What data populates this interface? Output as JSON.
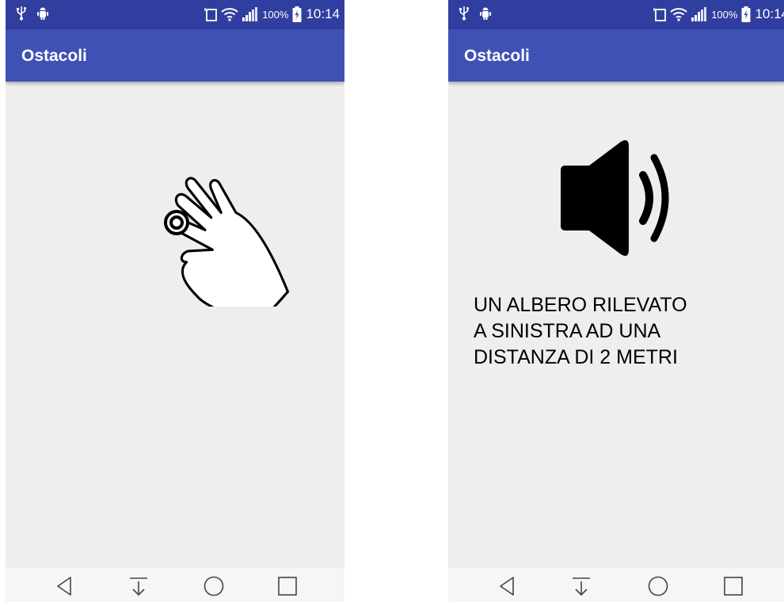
{
  "screens": [
    {
      "status": {
        "battery": "100%",
        "time": "10:14"
      },
      "app_title": "Ostacoli",
      "main_icon": "touch-gesture-hand-icon",
      "message_lines": []
    },
    {
      "status": {
        "battery": "100%",
        "time": "10:14"
      },
      "app_title": "Ostacoli",
      "main_icon": "speaker-volume-icon",
      "message_lines": [
        "UN ALBERO RILEVATO",
        "A SINISTRA AD UNA",
        "DISTANZA DI 2 METRI"
      ]
    }
  ],
  "colors": {
    "status_bar": "#303f9f",
    "app_bar": "#3f51b5",
    "background": "#eeeeee",
    "nav_bar": "#f6f6f6"
  },
  "nav_buttons": [
    "back-icon",
    "download-icon",
    "home-icon",
    "recents-icon"
  ]
}
